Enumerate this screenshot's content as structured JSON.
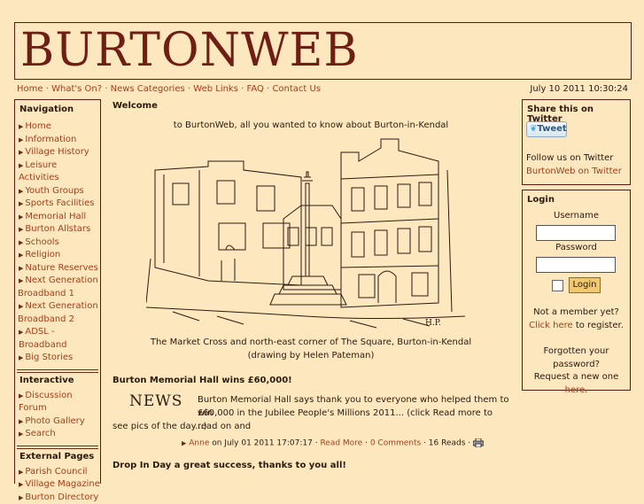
{
  "logo": "BURTONWEB",
  "topnav": {
    "links": [
      "Home",
      "What's On?",
      "News Categories",
      "Web Links",
      "FAQ",
      "Contact Us"
    ],
    "sep": "·"
  },
  "datetime": "July 10 2011 10:30:24",
  "navigation": {
    "heading": "Navigation",
    "items": [
      "Home",
      "Information",
      "Village History",
      "Leisure Activities",
      "Youth Groups",
      "Sports Facilities",
      "Memorial Hall",
      "Burton Allstars",
      "Schools",
      "Religion",
      "Nature Reserves"
    ],
    "ngb1_a": "Next Generation",
    "ngb1_b": "Broadband 1",
    "ngb2_a": "Next Generation",
    "ngb2_b": "Broadband 2",
    "adsl": "ADSL - Broadband",
    "big": "Big Stories"
  },
  "interactive": {
    "heading": "Interactive",
    "items": [
      "Discussion Forum",
      "Photo Gallery",
      "Search"
    ]
  },
  "external": {
    "heading": "External Pages",
    "items": [
      "Parish Council",
      "Village Magazine",
      "Burton Directory"
    ]
  },
  "main": {
    "welcome_heading": "Welcome",
    "welcome_text": "to BurtonWeb, all you wanted to know about Burton-in-Kendal",
    "caption1": "The Market Cross and north-east corner of The Square, Burton-in-Kendal",
    "caption2": "(drawing by Helen Pateman)",
    "article1_title": "Burton Memorial Hall wins £60,000!",
    "news_logo": "NEWS",
    "article1_line1": "Burton Memorial Hall says thank you to everyone who helped them to win",
    "article1_line2": "£60,000 in the Jubilee People's Millions 2011... (click Read more to read on and",
    "article1_line3": "see pics of the day...)",
    "meta_author": "Anne",
    "meta_on": " on July 01 2011 17:07:17 · ",
    "meta_readmore": "Read More",
    "meta_dot1": " · ",
    "meta_comments": "0 Comments",
    "meta_reads": " · 16 Reads · ",
    "article2_title": "Drop In Day a great success, thanks to you all!"
  },
  "twitter": {
    "heading": "Share this on Twitter",
    "button": "Tweet",
    "follow": "Follow us on Twitter",
    "link": "BurtonWeb on Twitter"
  },
  "login": {
    "heading": "Login",
    "username_label": "Username",
    "password_label": "Password",
    "button": "Login",
    "not_member": "Not a member yet?",
    "click": "Click ",
    "here": "here",
    "register": " to register.",
    "forgotten1": "Forgotten your",
    "forgotten2": "password?",
    "request": "Request a new one ",
    "here2": "here",
    "dot": "."
  }
}
